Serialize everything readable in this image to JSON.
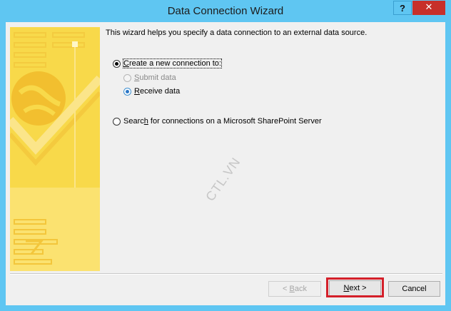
{
  "window": {
    "title": "Data Connection Wizard",
    "help_label": "?",
    "close_label": "✕"
  },
  "intro_text": "This wizard helps you specify a data connection to an external data source.",
  "options": {
    "create_new": {
      "prefix": "",
      "accel": "C",
      "rest": "reate a new connection to:"
    },
    "submit": {
      "accel": "S",
      "rest": "ubmit data"
    },
    "receive": {
      "accel": "R",
      "rest": "eceive data"
    },
    "search": {
      "prefix": "Searc",
      "accel": "h",
      "rest": " for connections on a Microsoft SharePoint Server"
    }
  },
  "watermark": "CTL.VN",
  "buttons": {
    "back": {
      "prefix": "< ",
      "accel": "B",
      "rest": "ack"
    },
    "next": {
      "accel": "N",
      "rest": "ext >"
    },
    "cancel": "Cancel"
  },
  "colors": {
    "frame": "#5fc6f2",
    "close": "#c7302a",
    "side_panel": "#f8d94a",
    "highlight": "#d4202a"
  }
}
